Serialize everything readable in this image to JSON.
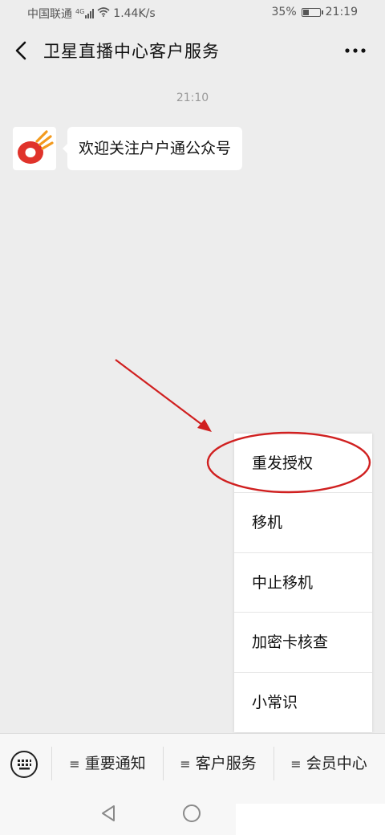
{
  "status_bar": {
    "carrier": "中国联通",
    "signal_label": "4G",
    "network_speed": "1.44K/s",
    "battery_percent": "35%",
    "battery_level": 0.35,
    "time": "21:19"
  },
  "nav": {
    "title": "卫星直播中心客户服务",
    "back_icon": "chevron-left-icon",
    "more_icon": "ellipsis-icon"
  },
  "chat": {
    "timestamp": "21:10",
    "messages": [
      {
        "sender": "official-account",
        "text": "欢迎关注户户通公众号"
      }
    ]
  },
  "submenu": {
    "items": [
      {
        "label": "重发授权",
        "highlighted": true
      },
      {
        "label": "移机"
      },
      {
        "label": "中止移机"
      },
      {
        "label": "加密卡核查"
      },
      {
        "label": "小常识"
      }
    ]
  },
  "menu_bar": {
    "keyboard_icon": "keyboard-icon",
    "menu_marker": "≡",
    "tabs": [
      {
        "label": "重要通知"
      },
      {
        "label": "客户服务"
      },
      {
        "label": "会员中心"
      }
    ]
  },
  "annotation": {
    "color": "#d02020",
    "shapes": [
      "arrow",
      "ellipse"
    ]
  },
  "colors": {
    "brand_red": "#e0332b",
    "brand_orange": "#f39a1e",
    "background": "#ededed"
  }
}
